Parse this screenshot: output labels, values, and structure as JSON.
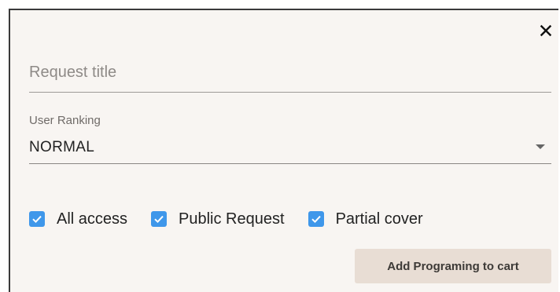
{
  "dialog": {
    "close_icon": "close-icon",
    "request_title": {
      "placeholder": "Request title",
      "value": ""
    },
    "user_ranking": {
      "label": "User Ranking",
      "selected": "NORMAL",
      "icon": "chevron-down-icon"
    },
    "checkboxes": [
      {
        "label": "All access",
        "checked": true
      },
      {
        "label": "Public Request",
        "checked": true
      },
      {
        "label": "Partial cover",
        "checked": true
      }
    ],
    "add_button_label": "Add Programing to cart"
  },
  "colors": {
    "dialog_bg": "#f8f5f2",
    "checkbox_accent": "#3f97ea",
    "button_bg": "#e8ddd4"
  }
}
